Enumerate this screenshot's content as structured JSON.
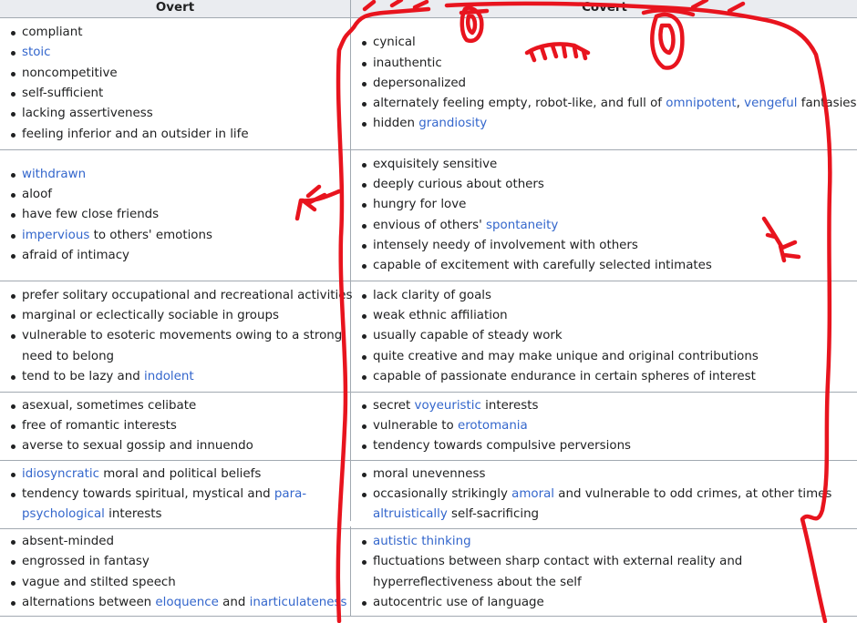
{
  "headers": {
    "overt": "Overt",
    "covert": "Covert"
  },
  "rows": [
    {
      "overt": [
        [
          {
            "t": "compliant"
          }
        ],
        [
          {
            "t": "stoic",
            "link": true
          }
        ],
        [
          {
            "t": "noncompetitive"
          }
        ],
        [
          {
            "t": "self-sufficient"
          }
        ],
        [
          {
            "t": "lacking assertiveness"
          }
        ],
        [
          {
            "t": "feeling inferior and an outsider in life"
          }
        ]
      ],
      "covert": [
        [
          {
            "t": "cynical"
          }
        ],
        [
          {
            "t": "inauthentic"
          }
        ],
        [
          {
            "t": "depersonalized"
          }
        ],
        [
          {
            "t": "alternately feeling empty, robot-like, and full of "
          },
          {
            "t": "omnipotent",
            "link": true
          },
          {
            "t": ", "
          },
          {
            "t": "vengeful",
            "link": true
          },
          {
            "t": " fantasies"
          }
        ],
        [
          {
            "t": "hidden "
          },
          {
            "t": "grandiosity",
            "link": true
          }
        ]
      ]
    },
    {
      "overt": [
        [
          {
            "t": "withdrawn",
            "link": true
          }
        ],
        [
          {
            "t": "aloof"
          }
        ],
        [
          {
            "t": "have few close friends"
          }
        ],
        [
          {
            "t": "impervious",
            "link": true
          },
          {
            "t": " to others' emotions"
          }
        ],
        [
          {
            "t": "afraid of intimacy"
          }
        ]
      ],
      "covert": [
        [
          {
            "t": "exquisitely sensitive"
          }
        ],
        [
          {
            "t": "deeply curious about others"
          }
        ],
        [
          {
            "t": "hungry for love"
          }
        ],
        [
          {
            "t": "envious of others' "
          },
          {
            "t": "spontaneity",
            "link": true
          }
        ],
        [
          {
            "t": "intensely needy of involvement with others"
          }
        ],
        [
          {
            "t": "capable of excitement with carefully selected intimates"
          }
        ]
      ]
    },
    {
      "overt": [
        [
          {
            "t": "prefer solitary occupational and recreational activities"
          }
        ],
        [
          {
            "t": "marginal or eclectically sociable in groups"
          }
        ],
        [
          {
            "t": "vulnerable to esoteric movements owing to a strong need to belong"
          }
        ],
        [
          {
            "t": "tend to be lazy and "
          },
          {
            "t": "indolent",
            "link": true
          }
        ]
      ],
      "covert": [
        [
          {
            "t": "lack clarity of goals"
          }
        ],
        [
          {
            "t": "weak ethnic affiliation"
          }
        ],
        [
          {
            "t": "usually capable of steady work"
          }
        ],
        [
          {
            "t": "quite creative and may make unique and original contributions"
          }
        ],
        [
          {
            "t": "capable of passionate endurance in certain spheres of interest"
          }
        ]
      ]
    },
    {
      "overt": [
        [
          {
            "t": "asexual, sometimes celibate"
          }
        ],
        [
          {
            "t": "free of romantic interests"
          }
        ],
        [
          {
            "t": "averse to sexual gossip and innuendo"
          }
        ]
      ],
      "covert": [
        [
          {
            "t": "secret "
          },
          {
            "t": "voyeuristic",
            "link": true
          },
          {
            "t": " interests"
          }
        ],
        [
          {
            "t": "vulnerable to "
          },
          {
            "t": "erotomania",
            "link": true
          }
        ],
        [
          {
            "t": "tendency towards compulsive perversions"
          }
        ]
      ]
    },
    {
      "overt": [
        [
          {
            "t": "idiosyncratic",
            "link": true
          },
          {
            "t": " moral and political beliefs"
          }
        ],
        [
          {
            "t": "tendency towards spiritual, mystical and "
          },
          {
            "t": "para-psychological",
            "link": true
          },
          {
            "t": " interests"
          }
        ]
      ],
      "covert": [
        [
          {
            "t": "moral unevenness"
          }
        ],
        [
          {
            "t": "occasionally strikingly "
          },
          {
            "t": "amoral",
            "link": true
          },
          {
            "t": " and vulnerable to odd crimes, at other times "
          },
          {
            "t": "altruistically",
            "link": true
          },
          {
            "t": " self-sacrificing"
          }
        ]
      ]
    },
    {
      "overt": [
        [
          {
            "t": "absent-minded"
          }
        ],
        [
          {
            "t": "engrossed in fantasy"
          }
        ],
        [
          {
            "t": "vague and stilted speech"
          }
        ],
        [
          {
            "t": "alternations between "
          },
          {
            "t": "eloquence",
            "link": true
          },
          {
            "t": " and "
          },
          {
            "t": "inarticulateness",
            "link": true
          }
        ]
      ],
      "covert": [
        [
          {
            "t": "autistic thinking",
            "link": true
          }
        ],
        [
          {
            "t": "fluctuations between sharp contact with external reality and hyperreflectiveness about the self"
          }
        ],
        [
          {
            "t": "autocentric use of language"
          }
        ]
      ]
    }
  ],
  "colors": {
    "link": "#3366cc",
    "header_bg": "#eaecf0",
    "border": "#a2a9b1",
    "scribble": "#e8141e"
  }
}
